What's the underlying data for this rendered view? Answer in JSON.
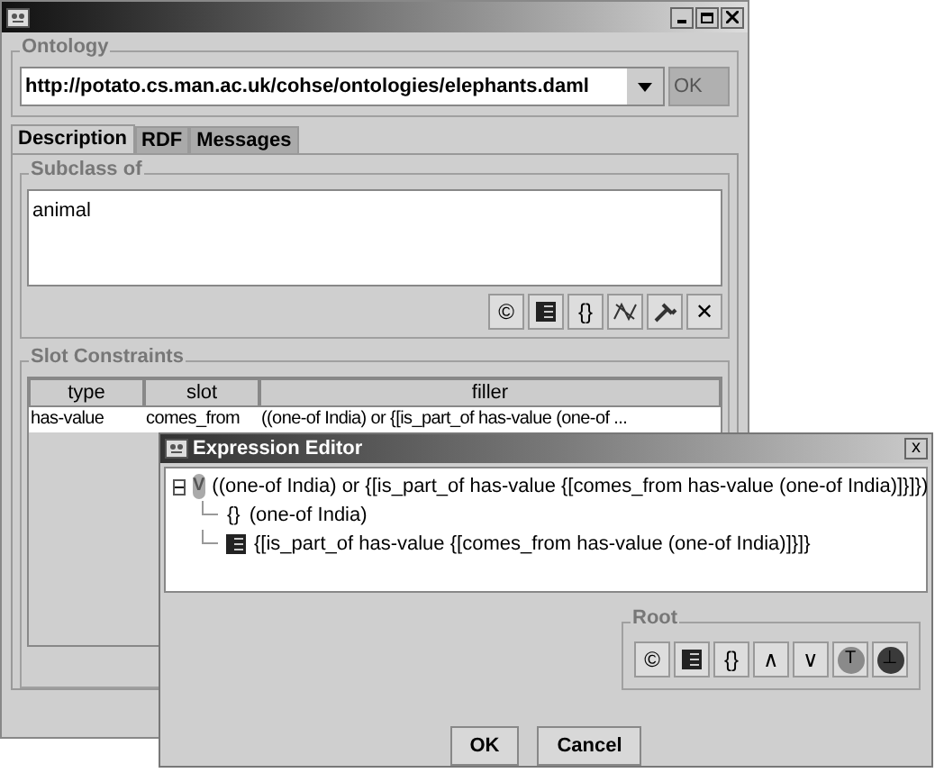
{
  "main_window": {
    "ontology": {
      "title": "Ontology",
      "url": "http://potato.cs.man.ac.uk/cohse/ontologies/elephants.daml",
      "ok_button": "OK",
      "ok_disabled": true
    },
    "tabs": [
      {
        "label": "Description",
        "selected": true
      },
      {
        "label": "RDF",
        "selected": false
      },
      {
        "label": "Messages",
        "selected": false
      }
    ],
    "subclass_of": {
      "title": "Subclass of",
      "items": [
        "animal"
      ],
      "toolbar": [
        {
          "kind": "glyph",
          "glyph": "©"
        },
        {
          "kind": "frame"
        },
        {
          "kind": "glyph",
          "glyph": "{}"
        },
        {
          "kind": "wave"
        },
        {
          "kind": "hammer"
        },
        {
          "kind": "glyph",
          "glyph": "✕"
        }
      ]
    },
    "slot_constraints": {
      "title": "Slot Constraints",
      "columns": [
        "type",
        "slot",
        "filler"
      ],
      "rows": [
        [
          "has-value",
          "comes_from",
          "((one-of India) or {[is_part_of has-value (one-of ..."
        ]
      ]
    }
  },
  "expression_editor": {
    "title": "Expression Editor",
    "close": "x",
    "tree": [
      {
        "kind": "or",
        "glyph": "V",
        "expanded": true,
        "text": "((one-of India) or {[is_part_of has-value {[comes_from has-value (one-of India)]}]})",
        "children": [
          {
            "kind": "braces",
            "glyph": "{}",
            "text": "(one-of India)"
          },
          {
            "kind": "frame",
            "text": "{[is_part_of has-value {[comes_from has-value (one-of India)]}]}"
          }
        ]
      }
    ],
    "root": {
      "title": "Root",
      "toolbar": [
        {
          "kind": "glyph",
          "glyph": "©"
        },
        {
          "kind": "frame"
        },
        {
          "kind": "glyph",
          "glyph": "{}"
        },
        {
          "kind": "glyph",
          "glyph": "∧"
        },
        {
          "kind": "glyph",
          "glyph": "∨"
        },
        {
          "kind": "circle",
          "glyph": "T",
          "color": "#8a8a8a"
        },
        {
          "kind": "circle",
          "glyph": "⊥",
          "color": "#3a3a3a"
        }
      ]
    },
    "buttons": [
      "OK",
      "Cancel"
    ]
  }
}
